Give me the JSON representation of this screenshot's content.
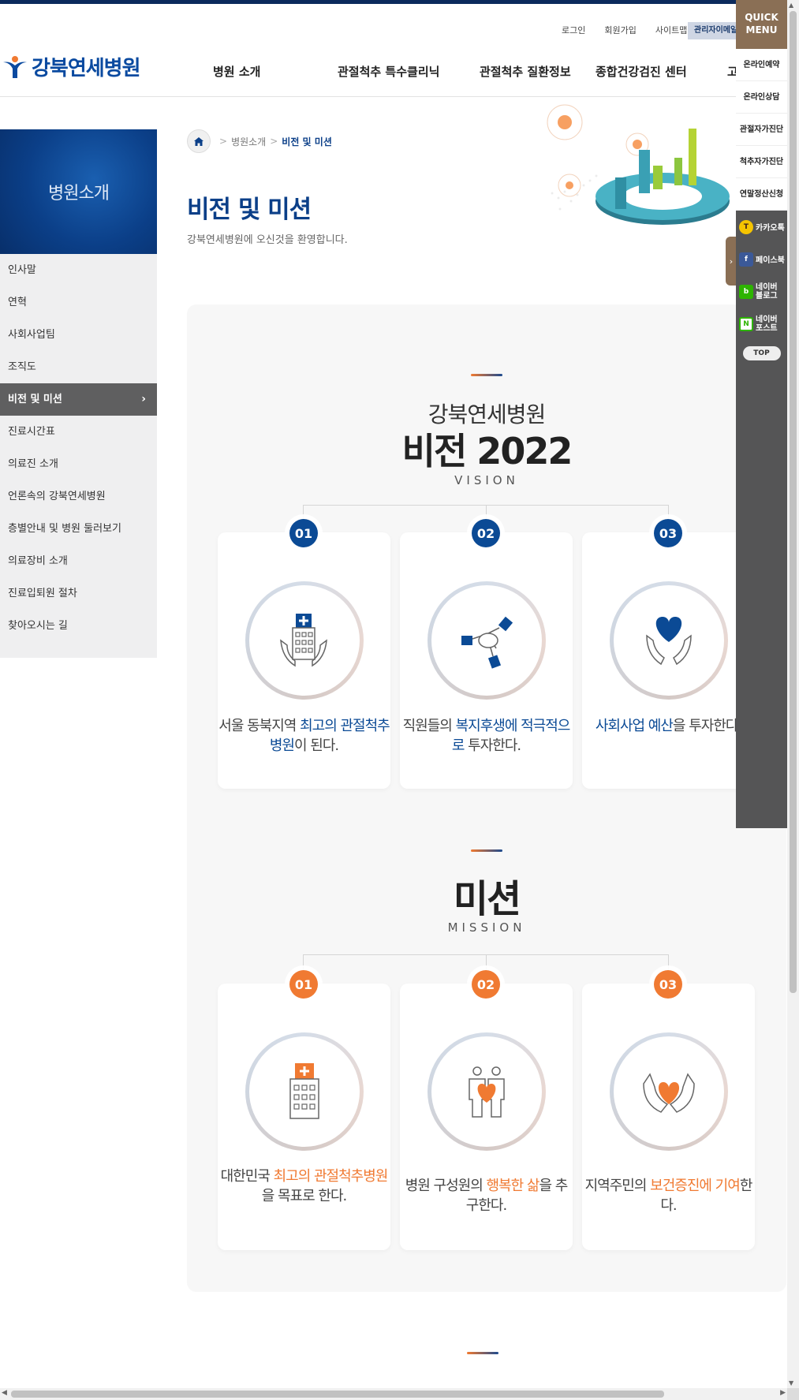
{
  "header": {
    "logo_text": "강북연세병원",
    "util_links": [
      "로그인",
      "회원가입",
      "사이트맵"
    ],
    "admin_tab": "관리자이메일",
    "gnb": [
      "병원 소개",
      "관절척추 특수클리닉",
      "관절척추 질환정보",
      "종합건강검진 센터",
      "고"
    ]
  },
  "sidebar": {
    "title": "병원소개",
    "items": [
      {
        "label": "인사말"
      },
      {
        "label": "연혁"
      },
      {
        "label": "사회사업팀"
      },
      {
        "label": "조직도"
      },
      {
        "label": "비전 및 미션",
        "active": true
      },
      {
        "label": "진료시간표"
      },
      {
        "label": "의료진 소개"
      },
      {
        "label": "언론속의 강북연세병원"
      },
      {
        "label": "층별안내 및 병원 둘러보기"
      },
      {
        "label": "의료장비 소개"
      },
      {
        "label": "진료입퇴원 절차"
      },
      {
        "label": "찾아오시는 길"
      }
    ],
    "active_chevron": "›"
  },
  "breadcrumb": {
    "items": [
      "병원소개",
      "비전 및 미션"
    ],
    "separator": ">"
  },
  "page": {
    "title": "비전 및 미션",
    "subtitle": "강북연세병원에 오신것을 환영합니다."
  },
  "vision": {
    "kicker": "강북연세병원",
    "title": "비전 2022",
    "en": "VISION",
    "cards": [
      {
        "num": "01",
        "pre": "서울 동북지역 ",
        "hl": "최고의 관절척추병원",
        "post": "이 된다.",
        "icon": "hospital-hands-icon"
      },
      {
        "num": "02",
        "pre": "직원들의 ",
        "hl": "복지후생에 적극적으로",
        "post": " 투자한다.",
        "icon": "handshake-icon"
      },
      {
        "num": "03",
        "pre": "",
        "hl": "사회사업 예산",
        "post": "을 투자한다.",
        "icon": "heart-hands-icon"
      }
    ]
  },
  "mission": {
    "title": "미션",
    "en": "MISSION",
    "cards": [
      {
        "num": "01",
        "pre": "대한민국 ",
        "hl": "최고의 관절척추병원",
        "post": "을 목표로 한다.",
        "icon": "hospital-building-icon"
      },
      {
        "num": "02",
        "pre": "병원 구성원의 ",
        "hl": "행복한 삶",
        "post": "을 추구한다.",
        "icon": "people-heart-icon"
      },
      {
        "num": "03",
        "pre": "지역주민의 ",
        "hl": "보건증진에 기여",
        "post": "한다.",
        "icon": "hands-heart-icon"
      }
    ]
  },
  "quick_menu": {
    "title_line1": "QUICK",
    "title_line2": "MENU",
    "items": [
      "온라인예약",
      "온라인상담",
      "관절자가진단",
      "척추자가진단",
      "연말정산신청"
    ],
    "sns": [
      {
        "label": "카카오톡",
        "icon": "kakaotalk-icon",
        "color": "#f5c400"
      },
      {
        "label": "페이스북",
        "icon": "facebook-icon",
        "color": "#3b5998"
      },
      {
        "label": "네이버 블로그",
        "icon": "naver-blog-icon",
        "color": "#2db400"
      },
      {
        "label": "네이버 포스트",
        "icon": "naver-post-icon",
        "color": "#2db400"
      }
    ],
    "top_label": "TOP",
    "toggle": "›"
  },
  "colors": {
    "brand_blue": "#0b3f88",
    "accent_orange": "#f07a32",
    "quick_brown": "#8a6f55"
  }
}
